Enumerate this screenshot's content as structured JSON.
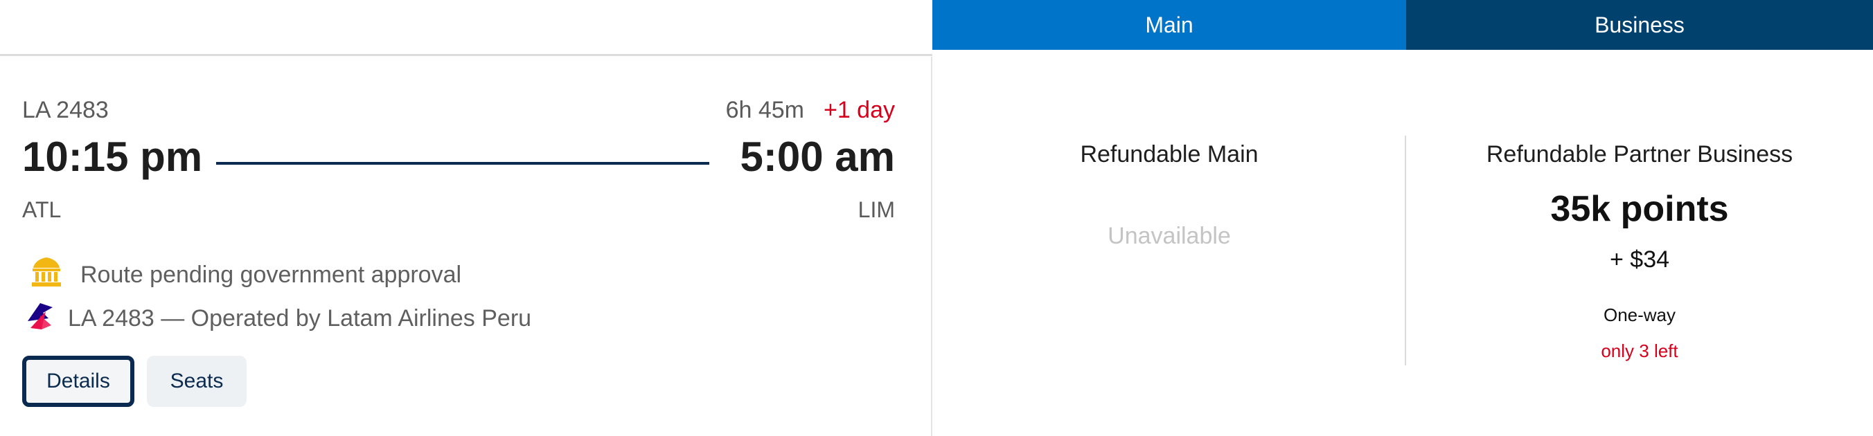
{
  "tabs": {
    "main": "Main",
    "business": "Business"
  },
  "flight": {
    "number": "LA 2483",
    "duration": "6h 45m",
    "day_offset": "+1 day",
    "departure_time": "10:15 pm",
    "arrival_time": "5:00 am",
    "origin": "ATL",
    "destination": "LIM",
    "notice": "Route pending government approval",
    "operated_by": "LA 2483 — Operated by Latam Airlines Peru"
  },
  "buttons": {
    "details": "Details",
    "seats": "Seats"
  },
  "fares": {
    "main": {
      "title": "Refundable Main",
      "status": "Unavailable"
    },
    "business": {
      "title": "Refundable Partner Business",
      "points": "35k points",
      "cash": "+ $34",
      "trip_type": "One-way",
      "availability": "only 3 left"
    }
  },
  "icons": {
    "notice_icon": "government-building-icon",
    "airline_icon": "latam-logo-icon"
  },
  "colors": {
    "tab_main": "#0074c8",
    "tab_business": "#00416e",
    "alert_red": "#d6001c",
    "navy": "#0b2a4f",
    "icon_gold": "#f2b712"
  }
}
